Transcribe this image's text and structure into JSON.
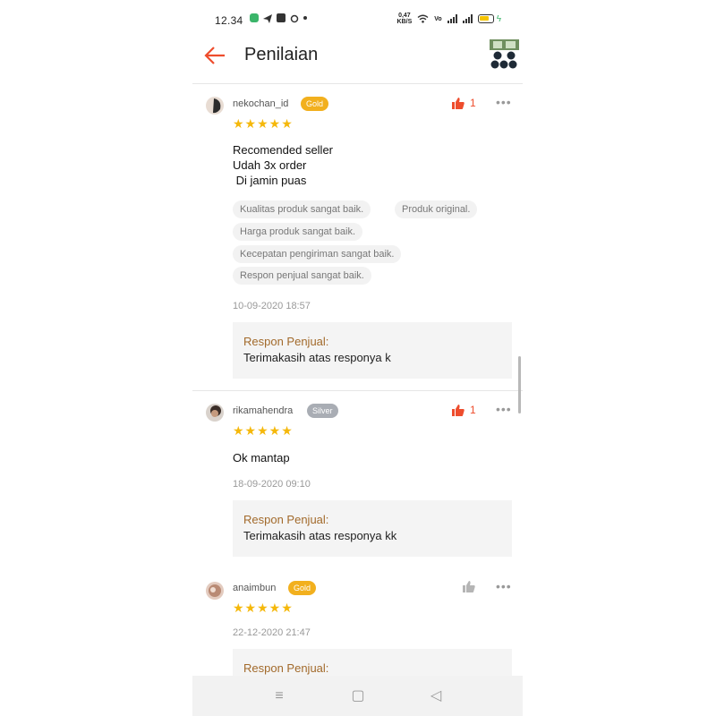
{
  "status_bar": {
    "time": "12.34",
    "net_speed_top": "0,47",
    "net_speed_bottom": "KB/S",
    "battery_level": 0.6
  },
  "header": {
    "title": "Penilaian",
    "back_icon": "arrow-left-icon",
    "thumbnail_icon": "product-thumbnail"
  },
  "colors": {
    "accent": "#ee4d2d",
    "star": "#f5b80b",
    "gold": "#f2b01e",
    "silver": "#a9adb4",
    "seller_label": "#a26a2b"
  },
  "reviews": [
    {
      "username": "nekochan_id",
      "badge": "Gold",
      "likes": "1",
      "stars": "★★★★★",
      "comment": "Recomended seller\nUdah 3x order\n Di jamin puas",
      "tags": [
        "Kualitas produk sangat baik.",
        "Produk original.",
        "Harga produk sangat baik.",
        "Kecepatan pengiriman sangat baik.",
        "Respon penjual sangat baik."
      ],
      "date": "10-09-2020 18:57",
      "seller_label": "Respon Penjual:",
      "seller_response": "Terimakasih atas responya k"
    },
    {
      "username": "rikamahendra",
      "badge": "Silver",
      "likes": "1",
      "stars": "★★★★★",
      "comment": "Ok mantap",
      "date": "18-09-2020 09:10",
      "seller_label": "Respon Penjual:",
      "seller_response": "Terimakasih atas responya kk"
    },
    {
      "username": "anaimbun",
      "badge": "Gold",
      "likes": "",
      "stars": "★★★★★",
      "date": "22-12-2020 21:47",
      "seller_label": "Respon Penjual:"
    }
  ],
  "more_glyph": "•••",
  "navbar": {
    "menu_icon": "≡",
    "home_icon": "▢",
    "back_icon": "◁"
  }
}
